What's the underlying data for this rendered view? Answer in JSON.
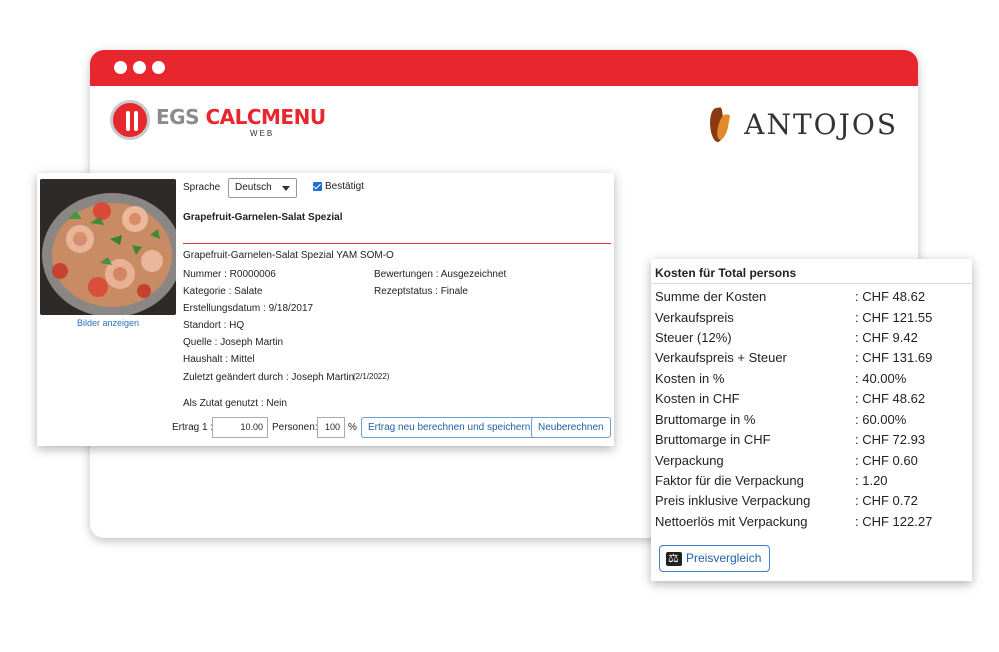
{
  "brand": {
    "egs_part1": "EGS ",
    "egs_part2": "CALCMENU",
    "egs_sub": "WEB",
    "client": "ANTOJOS"
  },
  "recipe": {
    "show_images": "Bilder anzeigen",
    "language_label": "Sprache",
    "language_value": "Deutsch",
    "confirmed_label": "Bestätigt",
    "title": "Grapefruit-Garnelen-Salat Spezial",
    "subtitle": "Grapefruit-Garnelen-Salat Spezial YAM SOM-O",
    "number": "Nummer : R0000006",
    "category": "Kategorie :  Salate",
    "created": "Erstellungsdatum : 9/18/2017",
    "location": "Standort : HQ",
    "source": "Quelle :  Joseph Martin",
    "household": "Haushalt : Mittel",
    "modified_by": "Zuletzt geändert durch : Joseph Martin",
    "modified_date": "(2/1/2022)",
    "rating": "Bewertungen : Ausgezeichnet",
    "status": "Rezeptstatus : Finale",
    "used_as_ingredient": "Als Zutat genutzt : Nein",
    "yield_label": "Ertrag 1 :",
    "yield_value": "10.00",
    "persons_label": "Personen:",
    "persons_value": "100",
    "percent": "%",
    "recalc_save": "Ertrag neu berechnen und speichern",
    "recalc": "Neuberechnen"
  },
  "costs": {
    "title": "Kosten für Total persons",
    "rows": [
      {
        "label": "Summe der Kosten",
        "value": ": CHF 48.62"
      },
      {
        "label": "Verkaufspreis",
        "value": ": CHF 121.55"
      },
      {
        "label": "Steuer (12%)",
        "value": ": CHF 9.42"
      },
      {
        "label": "Verkaufspreis + Steuer",
        "value": ": CHF 131.69"
      },
      {
        "label": "Kosten in %",
        "value": ": 40.00%"
      },
      {
        "label": "Kosten in CHF",
        "value": ": CHF 48.62"
      },
      {
        "label": "Bruttomarge in %",
        "value": ": 60.00%"
      },
      {
        "label": "Bruttomarge in CHF",
        "value": ": CHF 72.93"
      },
      {
        "label": "Verpackung",
        "value": ": CHF 0.60"
      },
      {
        "label": "Faktor für die Verpackung",
        "value": ": 1.20"
      },
      {
        "label": "Preis inklusive Verpackung",
        "value": ": CHF 0.72"
      },
      {
        "label": "Nettoerlös mit Verpackung",
        "value": ": CHF 122.27"
      }
    ],
    "compare_button": "Preisvergleich"
  },
  "colors": {
    "accent": "#e8262e",
    "link": "#1f5fa8"
  }
}
